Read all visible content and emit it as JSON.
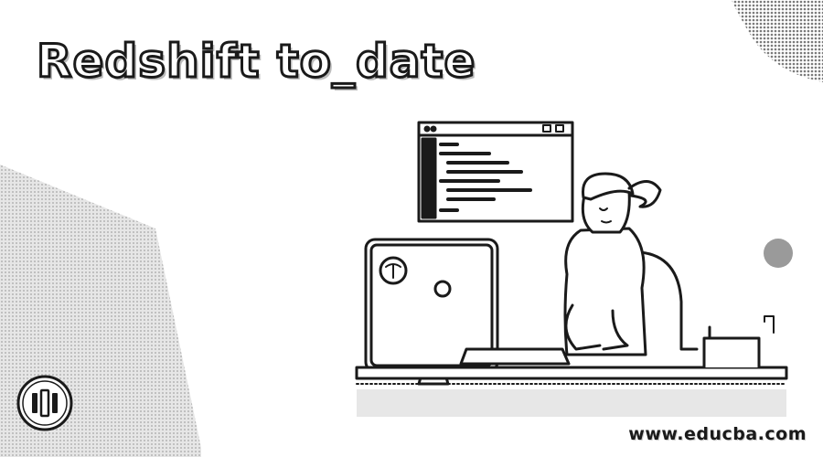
{
  "banner": {
    "title": "Redshift to_date",
    "website": "www.educba.com"
  },
  "colors": {
    "ink": "#1a1a1a",
    "shade": "#bdbdbd",
    "background": "#ffffff"
  },
  "icons": {
    "logo": "educba-logo-icon",
    "illustration": "woman-at-computer-illustration"
  }
}
